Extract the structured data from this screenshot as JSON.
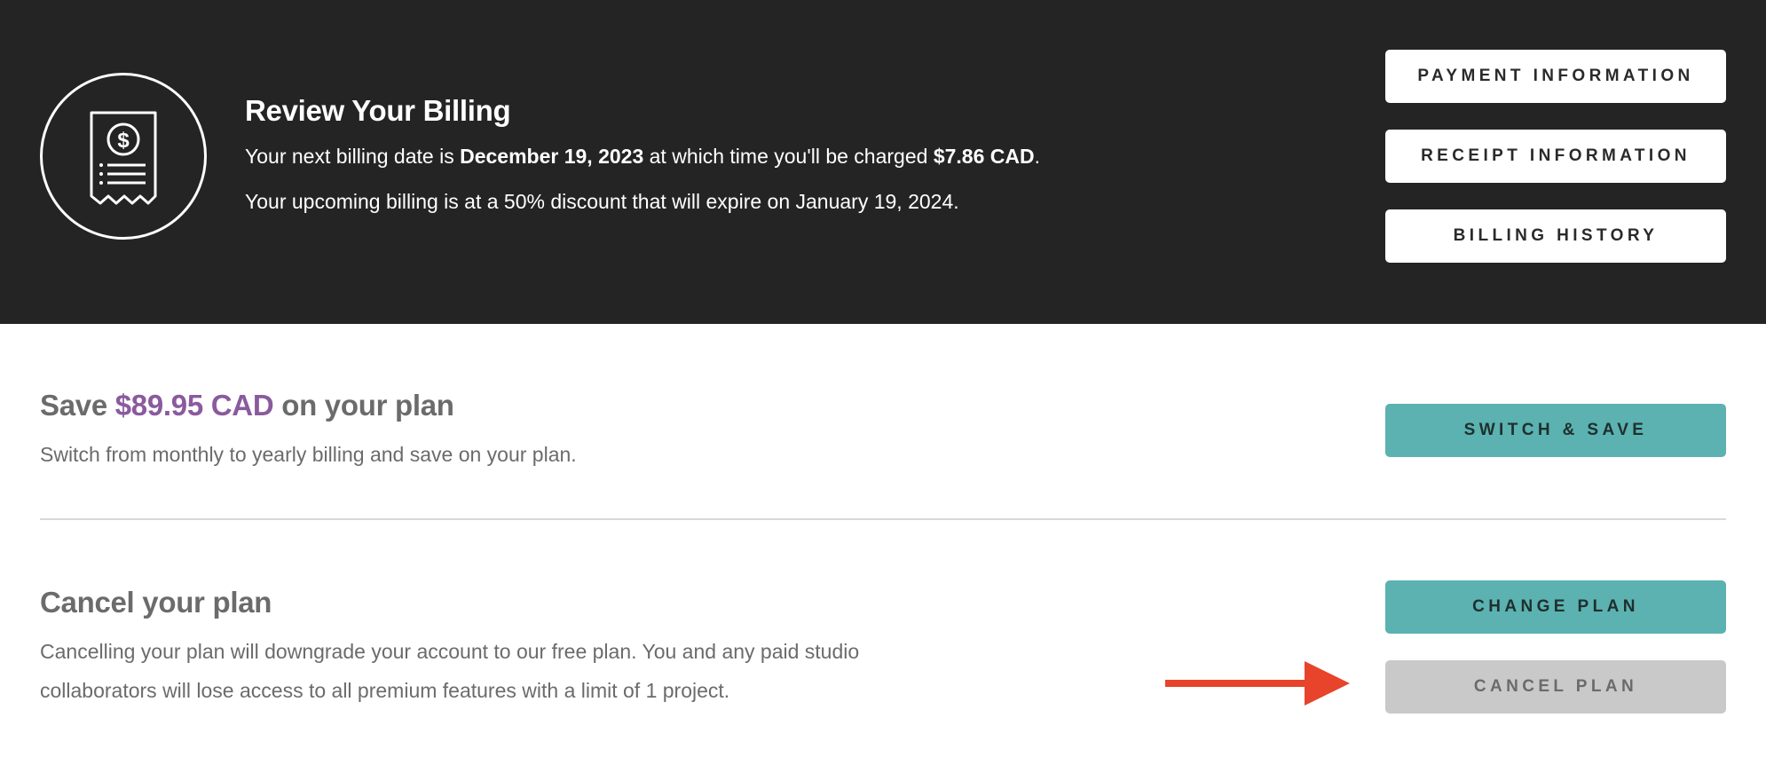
{
  "header": {
    "title": "Review Your Billing",
    "line1": {
      "prefix": "Your next billing date is ",
      "date": "December 19, 2023",
      "middle": " at which time you'll be charged ",
      "amount": "$7.86 CAD",
      "suffix": "."
    },
    "line2": "Your upcoming billing is at a 50% discount that will expire on January 19, 2024.",
    "buttons": {
      "payment": "PAYMENT INFORMATION",
      "receipt": "RECEIPT INFORMATION",
      "history": "BILLING HISTORY"
    }
  },
  "save": {
    "title_prefix": "Save ",
    "amount": "$89.95 CAD",
    "title_suffix": " on your plan",
    "description": "Switch from monthly to yearly billing and save on your plan.",
    "button": "SWITCH & SAVE"
  },
  "cancel": {
    "title": "Cancel your plan",
    "description_line1": "Cancelling your plan will downgrade your account to our free plan. You and any paid studio",
    "description_line2": "collaborators will lose access to all premium features with a limit of 1 project.",
    "change_button": "CHANGE PLAN",
    "cancel_button": "CANCEL PLAN"
  },
  "colors": {
    "header_bg": "#242424",
    "accent_teal": "#5bb2b0",
    "accent_purple": "#8a5a9e",
    "arrow_red": "#e8432b",
    "disabled_grey": "#c9c9c9"
  },
  "icons": {
    "receipt": "receipt-dollar-icon",
    "arrow": "arrow-right-icon"
  }
}
